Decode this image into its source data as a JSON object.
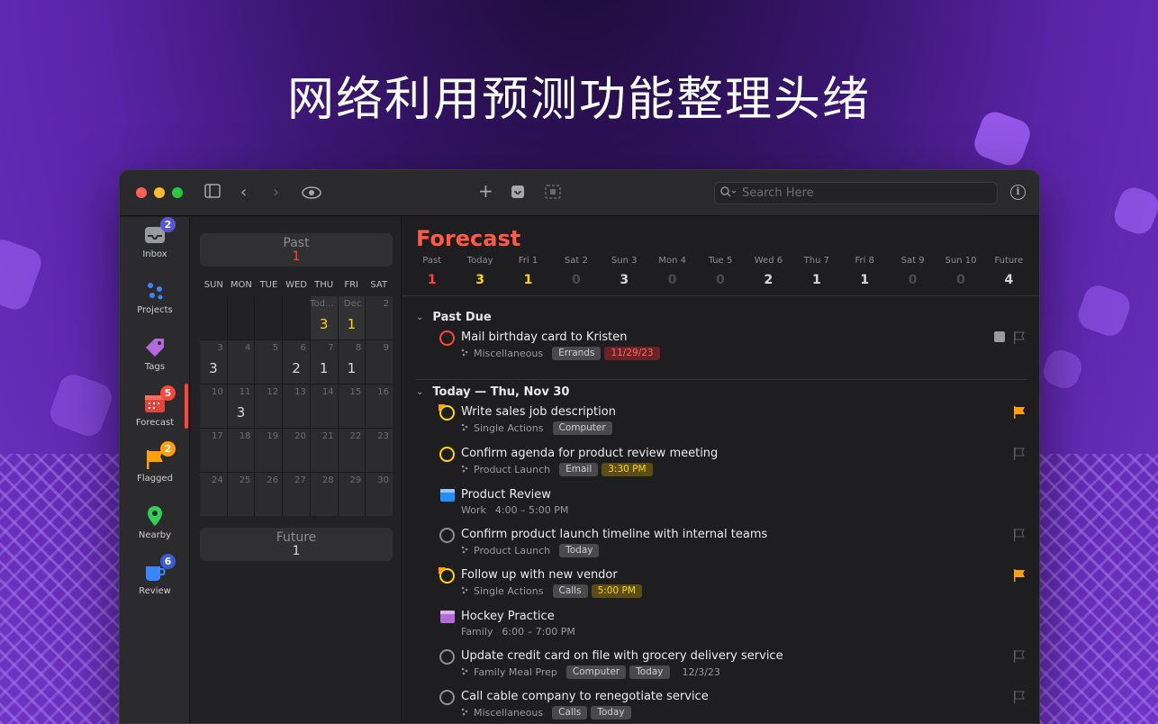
{
  "headline": "网络利用预测功能整理头绪",
  "colors": {
    "accent": "#ff5a46",
    "yellow": "#ffd60a",
    "orange": "#ff9f0a"
  },
  "toolbar": {
    "search_placeholder": "Search Here"
  },
  "sidebar": {
    "items": [
      {
        "label": "Inbox",
        "badge": "2",
        "icon": "inbox-icon"
      },
      {
        "label": "Projects",
        "badge": "",
        "icon": "projects-icon"
      },
      {
        "label": "Tags",
        "badge": "",
        "icon": "tag-icon"
      },
      {
        "label": "Forecast",
        "badge": "5",
        "icon": "forecast-icon"
      },
      {
        "label": "Flagged",
        "badge": "2",
        "icon": "flag-icon"
      },
      {
        "label": "Nearby",
        "badge": "",
        "icon": "location-pin-icon"
      },
      {
        "label": "Review",
        "badge": "6",
        "icon": "review-icon"
      }
    ]
  },
  "calendar": {
    "past": {
      "label": "Past",
      "count": "1"
    },
    "future": {
      "label": "Future",
      "count": "1"
    },
    "weekdays": [
      "SUN",
      "MON",
      "TUE",
      "WED",
      "THU",
      "FRI",
      "SAT"
    ],
    "cells": [
      {
        "d": "",
        "c": ""
      },
      {
        "d": "",
        "c": ""
      },
      {
        "d": "",
        "c": ""
      },
      {
        "d": "",
        "c": ""
      },
      {
        "d": "Tod...",
        "c": "3",
        "y": true
      },
      {
        "d": "Dec",
        "c": "1",
        "y": true
      },
      {
        "d": "2",
        "c": ""
      },
      {
        "d": "3",
        "c": "3"
      },
      {
        "d": "4",
        "c": ""
      },
      {
        "d": "5",
        "c": ""
      },
      {
        "d": "6",
        "c": "2"
      },
      {
        "d": "7",
        "c": "1"
      },
      {
        "d": "8",
        "c": "1"
      },
      {
        "d": "9",
        "c": ""
      },
      {
        "d": "10",
        "c": ""
      },
      {
        "d": "11",
        "c": "3"
      },
      {
        "d": "12",
        "c": ""
      },
      {
        "d": "13",
        "c": ""
      },
      {
        "d": "14",
        "c": ""
      },
      {
        "d": "15",
        "c": ""
      },
      {
        "d": "16",
        "c": ""
      },
      {
        "d": "17",
        "c": ""
      },
      {
        "d": "18",
        "c": ""
      },
      {
        "d": "19",
        "c": ""
      },
      {
        "d": "20",
        "c": ""
      },
      {
        "d": "21",
        "c": ""
      },
      {
        "d": "22",
        "c": ""
      },
      {
        "d": "23",
        "c": ""
      },
      {
        "d": "24",
        "c": ""
      },
      {
        "d": "25",
        "c": ""
      },
      {
        "d": "26",
        "c": ""
      },
      {
        "d": "27",
        "c": ""
      },
      {
        "d": "28",
        "c": ""
      },
      {
        "d": "29",
        "c": ""
      },
      {
        "d": "30",
        "c": ""
      }
    ]
  },
  "forecast": {
    "title": "Forecast",
    "days": [
      {
        "label": "Past",
        "count": "1",
        "color": "#ff453a"
      },
      {
        "label": "Today",
        "count": "3",
        "color": "#ffd60a"
      },
      {
        "label": "Fri 1",
        "count": "1",
        "color": "#ffd60a"
      },
      {
        "label": "Sat 2",
        "count": "0",
        "color": "#4a4a4d"
      },
      {
        "label": "Sun 3",
        "count": "3",
        "color": "#d8d8dc"
      },
      {
        "label": "Mon 4",
        "count": "0",
        "color": "#4a4a4d"
      },
      {
        "label": "Tue 5",
        "count": "0",
        "color": "#4a4a4d"
      },
      {
        "label": "Wed 6",
        "count": "2",
        "color": "#d8d8dc"
      },
      {
        "label": "Thu 7",
        "count": "1",
        "color": "#d8d8dc"
      },
      {
        "label": "Fri 8",
        "count": "1",
        "color": "#d8d8dc"
      },
      {
        "label": "Sat 9",
        "count": "0",
        "color": "#4a4a4d"
      },
      {
        "label": "Sun 10",
        "count": "0",
        "color": "#4a4a4d"
      },
      {
        "label": "Future",
        "count": "4",
        "color": "#d8d8dc"
      }
    ],
    "sections": {
      "past_due": "Past Due",
      "today": "Today — Thu, Nov 30"
    },
    "tasks": [
      {
        "title": "Mail birthday card to Kristen",
        "project": "Miscellaneous",
        "chips": [
          {
            "t": "Errands",
            "k": ""
          },
          {
            "t": "11/29/23",
            "k": "red"
          }
        ],
        "kind": "red",
        "flag": "outline",
        "note": true
      },
      {
        "title": "Write sales job description",
        "project": "Single Actions",
        "chips": [
          {
            "t": "Computer",
            "k": ""
          }
        ],
        "kind": "yellowflag",
        "flag": "filled"
      },
      {
        "title": "Confirm agenda for product review meeting",
        "project": "Product Launch",
        "chips": [
          {
            "t": "Email",
            "k": ""
          },
          {
            "t": "3:30 PM",
            "k": "yellow"
          }
        ],
        "kind": "yellow",
        "flag": "outline"
      },
      {
        "title": "Product Review",
        "project": "Work",
        "time": "4:00 – 5:00 PM",
        "kind": "event",
        "evcolor": "#1e90ff"
      },
      {
        "title": "Confirm product launch timeline with internal teams",
        "project": "Product Launch",
        "chips": [
          {
            "t": "Today",
            "k": ""
          }
        ],
        "kind": "grey",
        "flag": "outline"
      },
      {
        "title": "Follow up with new vendor",
        "project": "Single Actions",
        "chips": [
          {
            "t": "Calls",
            "k": ""
          },
          {
            "t": "5:00 PM",
            "k": "yellow"
          }
        ],
        "kind": "yellowflag",
        "flag": "filled"
      },
      {
        "title": "Hockey Practice",
        "project": "Family",
        "time": "6:00 – 7:00 PM",
        "kind": "event",
        "evcolor": "#b36bdc"
      },
      {
        "title": "Update credit card on file with grocery delivery service",
        "project": "Family Meal Prep",
        "chips": [
          {
            "t": "Computer",
            "k": ""
          },
          {
            "t": "Today",
            "k": ""
          }
        ],
        "date": "12/3/23",
        "kind": "grey",
        "flag": "outline"
      },
      {
        "title": "Call cable company to renegotiate service",
        "project": "Miscellaneous",
        "chips": [
          {
            "t": "Calls",
            "k": ""
          },
          {
            "t": "Today",
            "k": ""
          }
        ],
        "kind": "grey",
        "flag": "outline"
      }
    ]
  }
}
